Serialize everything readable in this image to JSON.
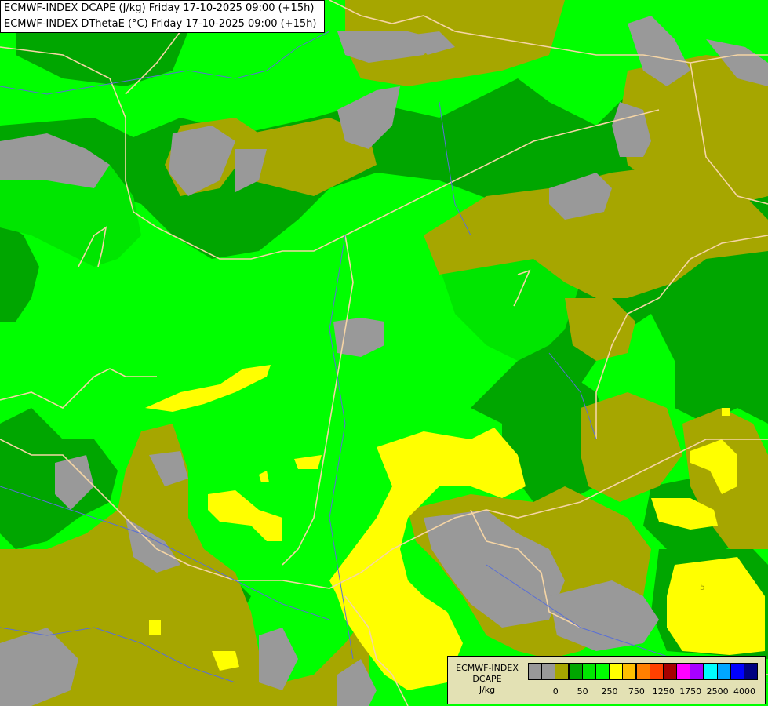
{
  "header": {
    "line1": "ECMWF-INDEX DCAPE (J/kg) Friday 17-10-2025 09:00 (+15h)",
    "line2": "ECMWF-INDEX DThetaE (°C) Friday 17-10-2025 09:00 (+15h)"
  },
  "legend": {
    "model": "ECMWF-INDEX",
    "parameter": "DCAPE",
    "unit": "J/kg",
    "swatch_colors": [
      "#999999",
      "#999999",
      "#a6a600",
      "#00a600",
      "#00e600",
      "#00ff00",
      "#ffff00",
      "#ffbf00",
      "#ff8000",
      "#ff4000",
      "#a60000",
      "#ff00ff",
      "#a600ff",
      "#00ffff",
      "#00a6ff",
      "#0000ff",
      "#000080"
    ],
    "ticks": [
      "0",
      "50",
      "250",
      "750",
      "1250",
      "1750",
      "2500",
      "4000"
    ]
  },
  "map": {
    "colors": {
      "zero": "#999999",
      "low": "#a6a600",
      "mid_dark": "#00a600",
      "mid": "#00e600",
      "bright": "#00ff00",
      "yellow": "#ffff00",
      "border": "#f5d5a5",
      "river": "#5a6fd6"
    },
    "contour_labels": [
      "5"
    ]
  }
}
